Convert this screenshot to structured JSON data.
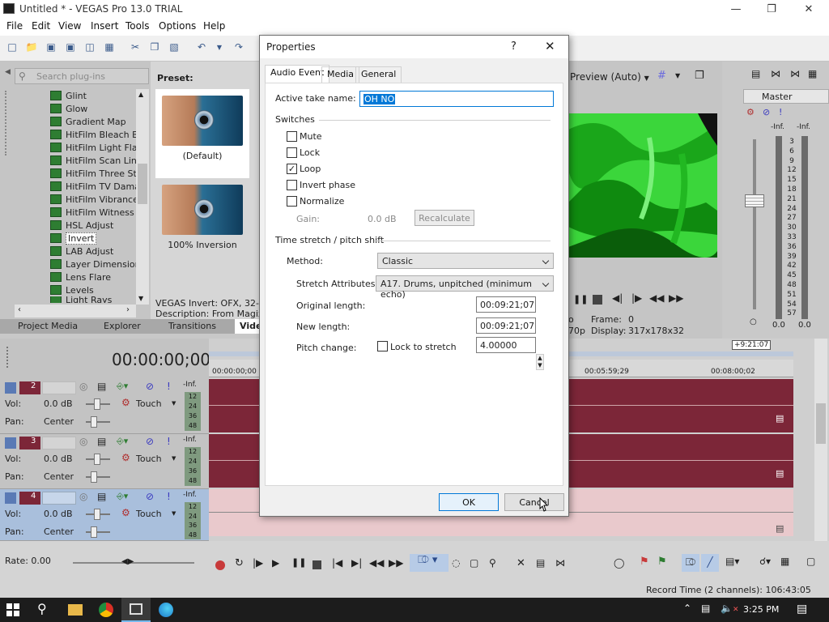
{
  "app": {
    "title": "Untitled * - VEGAS Pro 13.0 TRIAL",
    "menu": [
      "File",
      "Edit",
      "View",
      "Insert",
      "Tools",
      "Options",
      "Help"
    ]
  },
  "plugins": {
    "search_placeholder": "Search plug-ins",
    "items": [
      "Glint",
      "Glow",
      "Gradient Map",
      "HitFilm Bleach Byp",
      "HitFilm Light Flares",
      "HitFilm Scan Lines",
      "HitFilm Three Strip",
      "HitFilm TV Damage",
      "HitFilm Vibrance",
      "HitFilm Witness Pr",
      "HSL Adjust",
      "Invert",
      "LAB Adjust",
      "Layer Dimensional",
      "Lens Flare",
      "Levels",
      "Light Rays"
    ],
    "selected": "Invert"
  },
  "presets": {
    "header": "Preset:",
    "items": [
      "(Default)",
      "100% Inversion"
    ],
    "description_line1": "VEGAS Invert: OFX, 32-bit",
    "description_line2": "Description: From Magix Co"
  },
  "bottom_tabs": [
    "Project Media",
    "Explorer",
    "Transitions",
    "Video"
  ],
  "preview": {
    "mode": "Preview (Auto)",
    "frame_label": "Frame:",
    "frame_value": "0",
    "display_label": "Display:",
    "display_value": "317x178x32",
    "res_fragment": "70p",
    "p_fragment": "o"
  },
  "master": {
    "title": "Master",
    "inf_left": "-Inf.",
    "inf_right": "-Inf.",
    "scale": [
      "3",
      "6",
      "9",
      "12",
      "15",
      "18",
      "21",
      "24",
      "27",
      "30",
      "33",
      "36",
      "39",
      "42",
      "45",
      "48",
      "51",
      "54",
      "57"
    ],
    "foot_left": "0.0",
    "foot_right": "0.0"
  },
  "timeline": {
    "timecode": "00:00:00;00",
    "ruler": [
      "00:00:00;00",
      "00:05:59;29",
      "00:08:00;02"
    ],
    "end_marker": "+9:21:07",
    "tracks": [
      {
        "num": "2",
        "vol_label": "Vol:",
        "vol": "0.0 dB",
        "pan_label": "Pan:",
        "pan": "Center",
        "mode": "Touch",
        "inf": "-Inf."
      },
      {
        "num": "3",
        "vol_label": "Vol:",
        "vol": "0.0 dB",
        "pan_label": "Pan:",
        "pan": "Center",
        "mode": "Touch",
        "inf": "-Inf."
      },
      {
        "num": "4",
        "vol_label": "Vol:",
        "vol": "0.0 dB",
        "pan_label": "Pan:",
        "pan": "Center",
        "mode": "Touch",
        "inf": "-Inf."
      }
    ],
    "meter_scale": [
      "12",
      "24",
      "36",
      "48"
    ]
  },
  "transport": {
    "rate": "Rate: 0.00"
  },
  "status": {
    "record_time": "Record Time (2 channels): 106:43:05"
  },
  "taskbar": {
    "time": "3:25 PM"
  },
  "dialog": {
    "title": "Properties",
    "help": "?",
    "tabs": [
      "Audio Event",
      "Media",
      "General"
    ],
    "active_take_label": "Active take name:",
    "active_take_value": "OH NO",
    "switches_header": "Switches",
    "switches": [
      {
        "label": "Mute",
        "checked": false
      },
      {
        "label": "Lock",
        "checked": false
      },
      {
        "label": "Loop",
        "checked": true
      },
      {
        "label": "Invert phase",
        "checked": false
      },
      {
        "label": "Normalize",
        "checked": false
      }
    ],
    "gain_label": "Gain:",
    "gain_value": "0.0 dB",
    "recalculate": "Recalculate",
    "stretch_header": "Time stretch / pitch shift",
    "method_label": "Method:",
    "method_value": "Classic",
    "stretch_attr_label": "Stretch Attributes:",
    "stretch_attr_value": "A17. Drums, unpitched (minimum echo)",
    "orig_length_label": "Original length:",
    "orig_length_value": "00:09:21;07",
    "new_length_label": "New length:",
    "new_length_value": "00:09:21;07",
    "pitch_label": "Pitch change:",
    "lock_stretch_label": "Lock to stretch",
    "pitch_value": "4.00000",
    "ok": "OK",
    "cancel": "Cancel"
  },
  "colors": {
    "accent": "#0078d7",
    "clip": "#7c2638",
    "video": "#3bd63b"
  }
}
